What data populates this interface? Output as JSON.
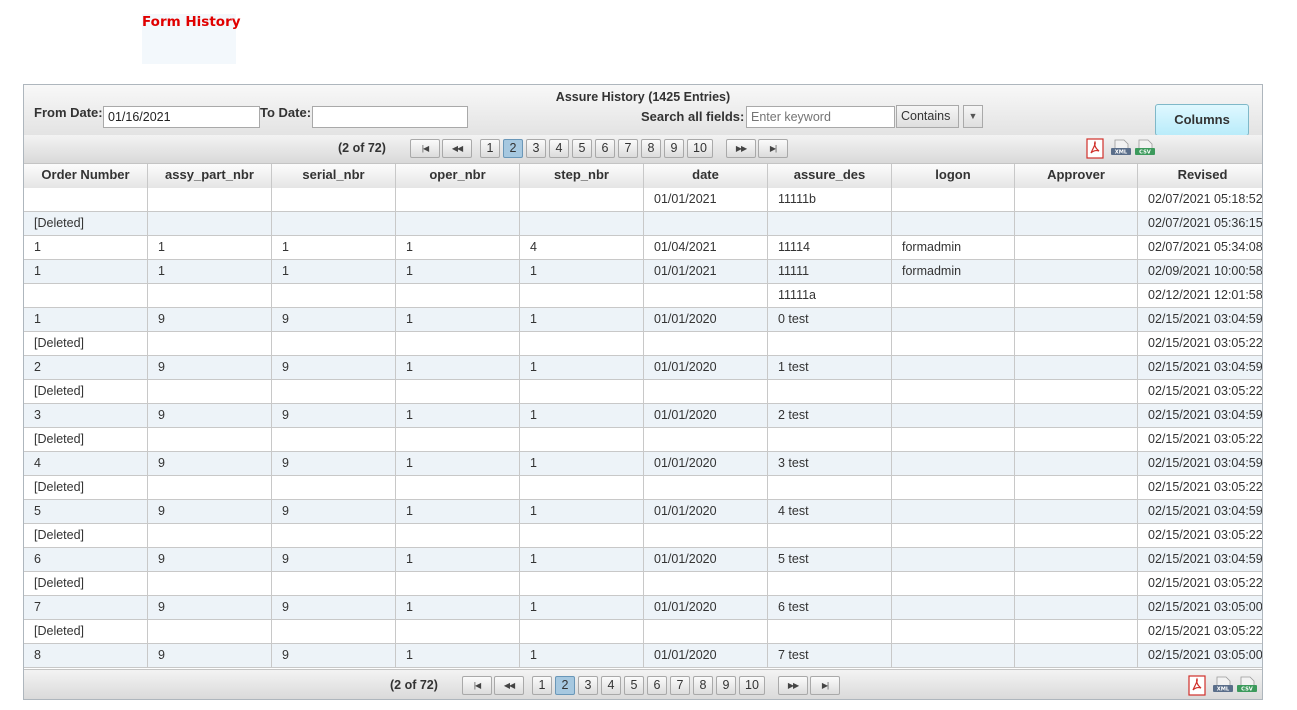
{
  "page": {
    "title": "Form History"
  },
  "grid": {
    "caption": "Assure History (1425 Entries)",
    "filters": {
      "from_label": "From Date:",
      "from_value": "01/16/2021",
      "to_label": "To Date:",
      "to_value": "",
      "search_label": "Search all fields:",
      "search_placeholder": "Enter keyword",
      "operator": "Contains",
      "columns_button": "Columns"
    },
    "pager": {
      "count": "(2 of 72)",
      "pages": [
        "1",
        "2",
        "3",
        "4",
        "5",
        "6",
        "7",
        "8",
        "9",
        "10"
      ],
      "active_page": "2",
      "first_icon": "first-page-icon",
      "prev_icon": "prev-page-icon",
      "next_icon": "next-page-icon",
      "last_icon": "last-page-icon",
      "export": [
        {
          "name": "pdf-export-icon",
          "label": ""
        },
        {
          "name": "xml-export-icon",
          "label": "XML"
        },
        {
          "name": "csv-export-icon",
          "label": "CSV"
        }
      ]
    },
    "columns": [
      "Order Number",
      "assy_part_nbr",
      "serial_nbr",
      "oper_nbr",
      "step_nbr",
      "date",
      "assure_des",
      "logon",
      "Approver",
      "Revised"
    ],
    "rows": [
      [
        "",
        "",
        "",
        "",
        "",
        "01/01/2021",
        "11111b",
        "",
        "",
        "02/07/2021 05:18:52"
      ],
      [
        "[Deleted]",
        "",
        "",
        "",
        "",
        "",
        "",
        "",
        "",
        "02/07/2021 05:36:15"
      ],
      [
        "1",
        "1",
        "1",
        "1",
        "4",
        "01/04/2021",
        "11114",
        "formadmin",
        "",
        "02/07/2021 05:34:08"
      ],
      [
        "1",
        "1",
        "1",
        "1",
        "1",
        "01/01/2021",
        "11111",
        "formadmin",
        "",
        "02/09/2021 10:00:58"
      ],
      [
        "",
        "",
        "",
        "",
        "",
        "",
        "11111a",
        "",
        "",
        "02/12/2021 12:01:58"
      ],
      [
        "1",
        "9",
        "9",
        "1",
        "1",
        "01/01/2020",
        "0 test",
        "",
        "",
        "02/15/2021 03:04:59"
      ],
      [
        "[Deleted]",
        "",
        "",
        "",
        "",
        "",
        "",
        "",
        "",
        "02/15/2021 03:05:22"
      ],
      [
        "2",
        "9",
        "9",
        "1",
        "1",
        "01/01/2020",
        "1 test",
        "",
        "",
        "02/15/2021 03:04:59"
      ],
      [
        "[Deleted]",
        "",
        "",
        "",
        "",
        "",
        "",
        "",
        "",
        "02/15/2021 03:05:22"
      ],
      [
        "3",
        "9",
        "9",
        "1",
        "1",
        "01/01/2020",
        "2 test",
        "",
        "",
        "02/15/2021 03:04:59"
      ],
      [
        "[Deleted]",
        "",
        "",
        "",
        "",
        "",
        "",
        "",
        "",
        "02/15/2021 03:05:22"
      ],
      [
        "4",
        "9",
        "9",
        "1",
        "1",
        "01/01/2020",
        "3 test",
        "",
        "",
        "02/15/2021 03:04:59"
      ],
      [
        "[Deleted]",
        "",
        "",
        "",
        "",
        "",
        "",
        "",
        "",
        "02/15/2021 03:05:22"
      ],
      [
        "5",
        "9",
        "9",
        "1",
        "1",
        "01/01/2020",
        "4 test",
        "",
        "",
        "02/15/2021 03:04:59"
      ],
      [
        "[Deleted]",
        "",
        "",
        "",
        "",
        "",
        "",
        "",
        "",
        "02/15/2021 03:05:22"
      ],
      [
        "6",
        "9",
        "9",
        "1",
        "1",
        "01/01/2020",
        "5 test",
        "",
        "",
        "02/15/2021 03:04:59"
      ],
      [
        "[Deleted]",
        "",
        "",
        "",
        "",
        "",
        "",
        "",
        "",
        "02/15/2021 03:05:22"
      ],
      [
        "7",
        "9",
        "9",
        "1",
        "1",
        "01/01/2020",
        "6 test",
        "",
        "",
        "02/15/2021 03:05:00"
      ],
      [
        "[Deleted]",
        "",
        "",
        "",
        "",
        "",
        "",
        "",
        "",
        "02/15/2021 03:05:22"
      ],
      [
        "8",
        "9",
        "9",
        "1",
        "1",
        "01/01/2020",
        "7 test",
        "",
        "",
        "02/15/2021 03:05:00"
      ]
    ]
  },
  "colors": {
    "title_red": "#e00000",
    "alt_row": "#edf3f8",
    "active_page": "#a6c8e0",
    "columns_btn": "#c9f1fc"
  }
}
